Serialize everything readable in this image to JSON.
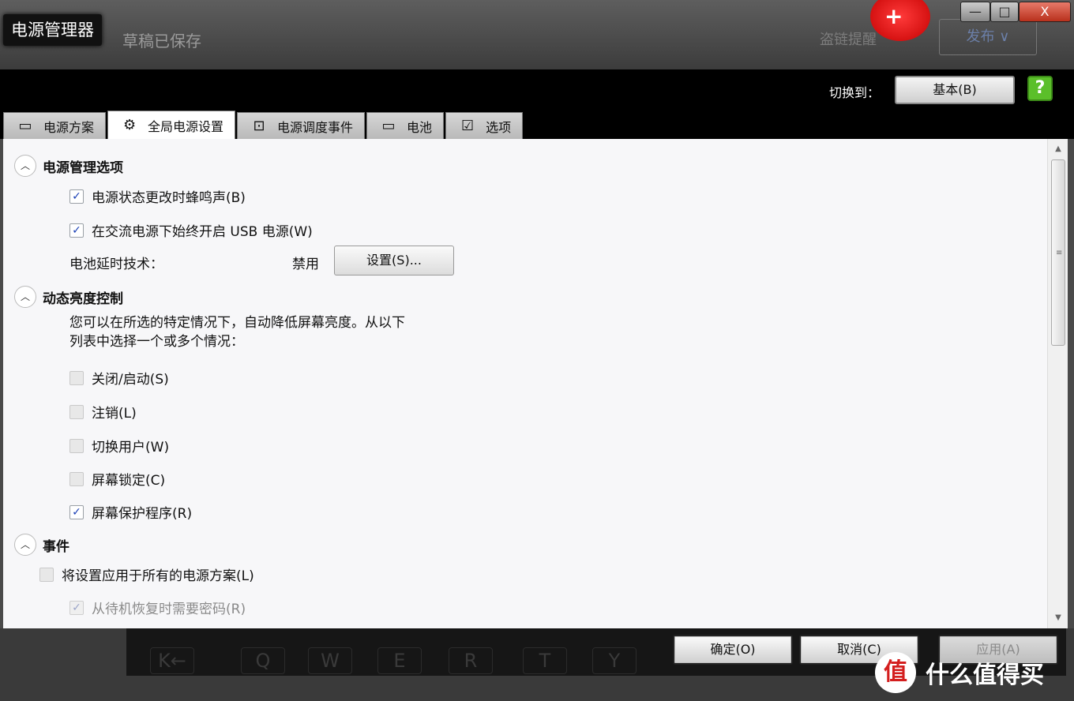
{
  "title_bar": {
    "app_title": "电源管理器",
    "bg_draft_status": "草稿已保存",
    "bg_mode_label": "盗链提醒",
    "bg_publish": "发布 ∨",
    "battery_badge": "+",
    "min": "—",
    "max": "□",
    "close": "X"
  },
  "header": {
    "switch_label": "切换到：",
    "basic_button": "基本(B)",
    "help": "?"
  },
  "tabs": [
    {
      "label": "电源方案",
      "icon": "monitor-icon",
      "glyph": "▭"
    },
    {
      "label": "全局电源设置",
      "icon": "gear-icon",
      "glyph": "⚙"
    },
    {
      "label": "电源调度事件",
      "icon": "clock-monitor-icon",
      "glyph": "⊡"
    },
    {
      "label": "电池",
      "icon": "battery-icon",
      "glyph": "▭"
    },
    {
      "label": "选项",
      "icon": "checklist-icon",
      "glyph": "☑"
    }
  ],
  "active_tab": 1,
  "sections": {
    "power_mgmt": {
      "title": "电源管理选项",
      "beep": "电源状态更改时蜂鸣声(B)",
      "usb": "在交流电源下始终开启 USB 电源(W)",
      "battery_tech_label": "电池延时技术：",
      "battery_tech_value": "禁用",
      "settings_button": "设置(S)..."
    },
    "brightness": {
      "title": "动态亮度控制",
      "desc_line1": "您可以在所选的特定情况下，自动降低屏幕亮度。从以下",
      "desc_line2": "列表中选择一个或多个情况：",
      "items": [
        {
          "label": "关闭/启动(S)",
          "checked": false
        },
        {
          "label": "注销(L)",
          "checked": false
        },
        {
          "label": "切换用户(W)",
          "checked": false
        },
        {
          "label": "屏幕锁定(C)",
          "checked": false
        },
        {
          "label": "屏幕保护程序(R)",
          "checked": true
        }
      ]
    },
    "events": {
      "title": "事件",
      "apply_all": "将设置应用于所有的电源方案(L)",
      "require_password": "从待机恢复时需要密码(R)"
    }
  },
  "check_glyph": "✓",
  "expand_glyph": "︿",
  "scroll": {
    "up": "▲",
    "down": "▼",
    "grip": "≡"
  },
  "footer": {
    "ok": "确定(O)",
    "cancel": "取消(C)",
    "apply": "应用(A)",
    "keys": [
      "K←",
      "Q",
      "W",
      "E",
      "R",
      "T",
      "Y"
    ]
  },
  "watermark": {
    "logo": "值",
    "text": "什么值得买"
  }
}
